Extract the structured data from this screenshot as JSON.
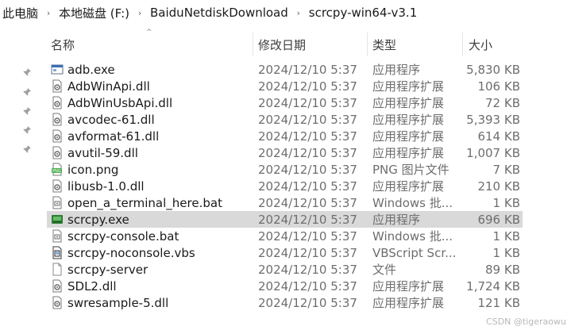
{
  "breadcrumb": {
    "items": [
      "此电脑",
      "本地磁盘 (F:)",
      "BaiduNetdiskDownload",
      "scrcpy-win64-v3.1"
    ],
    "separator": "›"
  },
  "columns": {
    "name": "名称",
    "date": "修改日期",
    "type": "类型",
    "size": "大小"
  },
  "sort_indicator": "^",
  "pin_glyph": "📌",
  "files": [
    {
      "name": "adb.exe",
      "date": "2024/12/10 5:37",
      "type": "应用程序",
      "size": "5,830 KB",
      "icon": "exe-window-icon"
    },
    {
      "name": "AdbWinApi.dll",
      "date": "2024/12/10 5:37",
      "type": "应用程序扩展",
      "size": "106 KB",
      "icon": "dll-gear-icon"
    },
    {
      "name": "AdbWinUsbApi.dll",
      "date": "2024/12/10 5:37",
      "type": "应用程序扩展",
      "size": "72 KB",
      "icon": "dll-gear-icon"
    },
    {
      "name": "avcodec-61.dll",
      "date": "2024/12/10 5:37",
      "type": "应用程序扩展",
      "size": "5,393 KB",
      "icon": "dll-gear-icon"
    },
    {
      "name": "avformat-61.dll",
      "date": "2024/12/10 5:37",
      "type": "应用程序扩展",
      "size": "614 KB",
      "icon": "dll-gear-icon"
    },
    {
      "name": "avutil-59.dll",
      "date": "2024/12/10 5:37",
      "type": "应用程序扩展",
      "size": "1,007 KB",
      "icon": "dll-gear-icon"
    },
    {
      "name": "icon.png",
      "date": "2024/12/10 5:37",
      "type": "PNG 图片文件",
      "size": "7 KB",
      "icon": "png-image-icon"
    },
    {
      "name": "libusb-1.0.dll",
      "date": "2024/12/10 5:37",
      "type": "应用程序扩展",
      "size": "210 KB",
      "icon": "dll-gear-icon"
    },
    {
      "name": "open_a_terminal_here.bat",
      "date": "2024/12/10 5:37",
      "type": "Windows 批...",
      "size": "1 KB",
      "icon": "bat-script-icon"
    },
    {
      "name": "scrcpy.exe",
      "date": "2024/12/10 5:37",
      "type": "应用程序",
      "size": "696 KB",
      "icon": "scrcpy-app-icon",
      "selected": true
    },
    {
      "name": "scrcpy-console.bat",
      "date": "2024/12/10 5:37",
      "type": "Windows 批...",
      "size": "1 KB",
      "icon": "bat-script-icon"
    },
    {
      "name": "scrcpy-noconsole.vbs",
      "date": "2024/12/10 5:37",
      "type": "VBScript Scr...",
      "size": "1 KB",
      "icon": "vbs-script-icon"
    },
    {
      "name": "scrcpy-server",
      "date": "2024/12/10 5:37",
      "type": "文件",
      "size": "89 KB",
      "icon": "blank-file-icon"
    },
    {
      "name": "SDL2.dll",
      "date": "2024/12/10 5:37",
      "type": "应用程序扩展",
      "size": "1,724 KB",
      "icon": "dll-gear-icon"
    },
    {
      "name": "swresample-5.dll",
      "date": "2024/12/10 5:37",
      "type": "应用程序扩展",
      "size": "121 KB",
      "icon": "dll-gear-icon"
    }
  ],
  "watermark": "CSDN @tigeraowu",
  "colors": {
    "selected_row": "#d9d9d9",
    "secondary_text": "#6e6e6e",
    "png_icon_green": "#4caf50",
    "scrcpy_icon_green": "#2e7d32"
  }
}
